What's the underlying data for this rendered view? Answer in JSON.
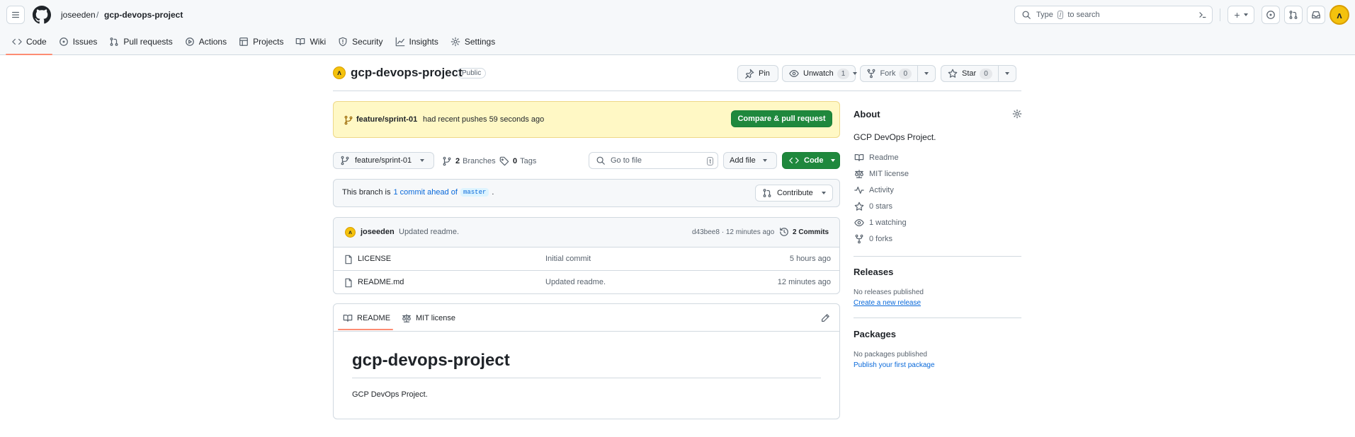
{
  "header": {
    "owner": "joseeden",
    "separator": "/",
    "repo": "gcp-devops-project",
    "search": {
      "prefix": "Type",
      "key": "/",
      "suffix": "to search"
    },
    "new_label": "+"
  },
  "tabs": [
    {
      "label": "Code",
      "icon": "code-icon"
    },
    {
      "label": "Issues",
      "icon": "issue-icon"
    },
    {
      "label": "Pull requests",
      "icon": "pull-request-icon"
    },
    {
      "label": "Actions",
      "icon": "play-icon"
    },
    {
      "label": "Projects",
      "icon": "table-icon"
    },
    {
      "label": "Wiki",
      "icon": "book-icon"
    },
    {
      "label": "Security",
      "icon": "shield-icon"
    },
    {
      "label": "Insights",
      "icon": "graph-icon"
    },
    {
      "label": "Settings",
      "icon": "gear-icon"
    }
  ],
  "repo": {
    "name": "gcp-devops-project",
    "visibility": "Public",
    "pin_label": "Pin",
    "unwatch_label": "Unwatch",
    "watch_count": "1",
    "fork_label": "Fork",
    "fork_count": "0",
    "star_label": "Star",
    "star_count": "0"
  },
  "banner": {
    "branch": "feature/sprint-01",
    "text": "had recent pushes 59 seconds ago",
    "button": "Compare & pull request"
  },
  "toolbar": {
    "branch": "feature/sprint-01",
    "branches_count": "2",
    "branches_label": "Branches",
    "tags_count": "0",
    "tags_label": "Tags",
    "goto_placeholder": "Go to file",
    "goto_key": "t",
    "add_file": "Add file",
    "code": "Code"
  },
  "ahead": {
    "prefix": "This branch is",
    "link": "1 commit ahead of",
    "base": "master",
    "suffix": ".",
    "contribute": "Contribute"
  },
  "commit": {
    "author": "joseeden",
    "message": "Updated readme.",
    "hash_time": "d43bee8 · 12 minutes ago",
    "commits_label": "2 Commits"
  },
  "files": [
    {
      "name": "LICENSE",
      "message": "Initial commit",
      "time": "5 hours ago"
    },
    {
      "name": "README.md",
      "message": "Updated readme.",
      "time": "12 minutes ago"
    }
  ],
  "readme": {
    "tab_readme": "README",
    "tab_license": "MIT license",
    "title": "gcp-devops-project",
    "body": "GCP DevOps Project."
  },
  "about": {
    "heading": "About",
    "description": "GCP DevOps Project.",
    "items": [
      {
        "label": "Readme",
        "icon": "book-icon"
      },
      {
        "label": "MIT license",
        "icon": "law-icon"
      },
      {
        "label": "Activity",
        "icon": "pulse-icon"
      },
      {
        "label": "0 stars",
        "icon": "star-icon"
      },
      {
        "label": "1 watching",
        "icon": "eye-icon"
      },
      {
        "label": "0 forks",
        "icon": "fork-icon"
      }
    ]
  },
  "releases": {
    "heading": "Releases",
    "empty": "No releases published",
    "link": "Create a new release"
  },
  "packages": {
    "heading": "Packages",
    "empty": "No packages published",
    "link": "Publish your first package"
  },
  "colors": {
    "accent": "#0969da",
    "green": "#1f883d",
    "banner_bg": "#fff8c5",
    "tab_underline": "#fd8c73"
  }
}
